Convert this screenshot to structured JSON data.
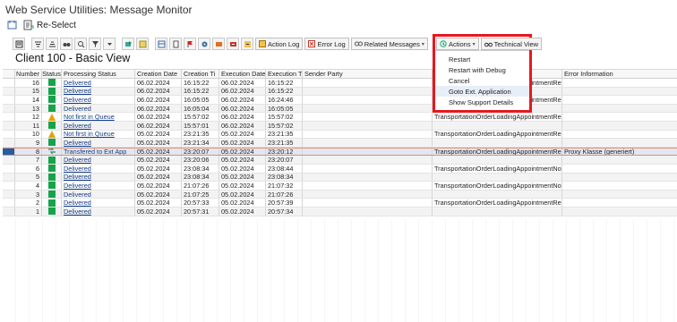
{
  "window": {
    "title": "Web Service Utilities: Message Monitor"
  },
  "menu": {
    "reselect_label": "Re-Select"
  },
  "toolbar": {
    "action_log": "Action Log",
    "error_log": "Error Log",
    "related_messages": "Related Messages",
    "actions": "Actions",
    "technical_view": "Technical View"
  },
  "view": {
    "title": "Client 100 - Basic View"
  },
  "table": {
    "headers": {
      "number": "Number",
      "status": "Status",
      "processing_status": "Processing Status",
      "creation_date": "Creation Date",
      "creation_time": "Creation Ti",
      "execution_date": "Execution Date",
      "execution_time": "Execution Ti",
      "sender_party": "Sender Party",
      "receiver": "",
      "error_info": "Error Information"
    },
    "rows": [
      {
        "number": "16",
        "status": "ok",
        "proc": "Delivered",
        "cdate": "06.02.2024",
        "ctime": "16:15:22",
        "edate": "06.02.2024",
        "etime": "16:15:22",
        "receiver": "TransportationOrderLoadingAppointmentRequ",
        "error": ""
      },
      {
        "number": "15",
        "status": "ok",
        "proc": "Delivered",
        "cdate": "06.02.2024",
        "ctime": "16:15:22",
        "edate": "06.02.2024",
        "etime": "16:15:22",
        "receiver": "",
        "error": ""
      },
      {
        "number": "14",
        "status": "ok",
        "proc": "Delivered",
        "cdate": "06.02.2024",
        "ctime": "16:05:05",
        "edate": "06.02.2024",
        "etime": "16:24:46",
        "receiver": "TransportationOrderLoadingAppointmentRequ",
        "error": ""
      },
      {
        "number": "13",
        "status": "ok",
        "proc": "Delivered",
        "cdate": "06.02.2024",
        "ctime": "16:05:04",
        "edate": "06.02.2024",
        "etime": "16:05:05",
        "receiver": "",
        "error": ""
      },
      {
        "number": "12",
        "status": "warn",
        "proc": "Not first in Queue",
        "cdate": "06.02.2024",
        "ctime": "15:57:02",
        "edate": "06.02.2024",
        "etime": "15:57:02",
        "receiver": "TransportationOrderLoadingAppointmentRequ",
        "error": ""
      },
      {
        "number": "11",
        "status": "ok",
        "proc": "Delivered",
        "cdate": "06.02.2024",
        "ctime": "15:57:01",
        "edate": "06.02.2024",
        "etime": "15:57:02",
        "receiver": "",
        "error": ""
      },
      {
        "number": "10",
        "status": "warn",
        "proc": "Not first in Queue",
        "cdate": "05.02.2024",
        "ctime": "23:21:35",
        "edate": "05.02.2024",
        "etime": "23:21:35",
        "receiver": "TransportationOrderLoadingAppointmentRequ",
        "error": ""
      },
      {
        "number": "9",
        "status": "ok",
        "proc": "Delivered",
        "cdate": "05.02.2024",
        "ctime": "23:21:34",
        "edate": "05.02.2024",
        "etime": "23:21:35",
        "receiver": "",
        "error": ""
      },
      {
        "number": "8",
        "status": "transfer",
        "proc": "Transfered to Ext App",
        "cdate": "05.02.2024",
        "ctime": "23:20:07",
        "edate": "05.02.2024",
        "etime": "23:20:12",
        "receiver": "TransportationOrderLoadingAppointmentRequ",
        "error": "Proxy Klasse (generiert)"
      },
      {
        "number": "7",
        "status": "ok",
        "proc": "Delivered",
        "cdate": "05.02.2024",
        "ctime": "23:20:06",
        "edate": "05.02.2024",
        "etime": "23:20:07",
        "receiver": "",
        "error": ""
      },
      {
        "number": "6",
        "status": "ok",
        "proc": "Delivered",
        "cdate": "05.02.2024",
        "ctime": "23:08:34",
        "edate": "05.02.2024",
        "etime": "23:08:44",
        "receiver": "TransportationOrderLoadingAppointmentNotifi",
        "error": ""
      },
      {
        "number": "5",
        "status": "ok",
        "proc": "Delivered",
        "cdate": "05.02.2024",
        "ctime": "23:08:34",
        "edate": "05.02.2024",
        "etime": "23:08:34",
        "receiver": "",
        "error": ""
      },
      {
        "number": "4",
        "status": "ok",
        "proc": "Delivered",
        "cdate": "05.02.2024",
        "ctime": "21:07:26",
        "edate": "05.02.2024",
        "etime": "21:07:32",
        "receiver": "TransportationOrderLoadingAppointmentNotifi",
        "error": ""
      },
      {
        "number": "3",
        "status": "ok",
        "proc": "Delivered",
        "cdate": "05.02.2024",
        "ctime": "21:07:25",
        "edate": "05.02.2024",
        "etime": "21:07:26",
        "receiver": "",
        "error": ""
      },
      {
        "number": "2",
        "status": "ok",
        "proc": "Delivered",
        "cdate": "05.02.2024",
        "ctime": "20:57:33",
        "edate": "05.02.2024",
        "etime": "20:57:39",
        "receiver": "TransportationOrderLoadingAppointmentRequ",
        "error": ""
      },
      {
        "number": "1",
        "status": "ok",
        "proc": "Delivered",
        "cdate": "05.02.2024",
        "ctime": "20:57:31",
        "edate": "05.02.2024",
        "etime": "20:57:34",
        "receiver": "",
        "error": ""
      }
    ],
    "selected_index": 8
  },
  "actions_menu": {
    "items": [
      "Restart",
      "Restart with Debug",
      "Cancel",
      "Goto Ext. Application",
      "Show Support Details"
    ],
    "highlighted_index": 3
  },
  "colors": {
    "ok": "#16a34a",
    "warn": "#e8a200",
    "highlight_box": "#e8171f",
    "link": "#143d86"
  }
}
